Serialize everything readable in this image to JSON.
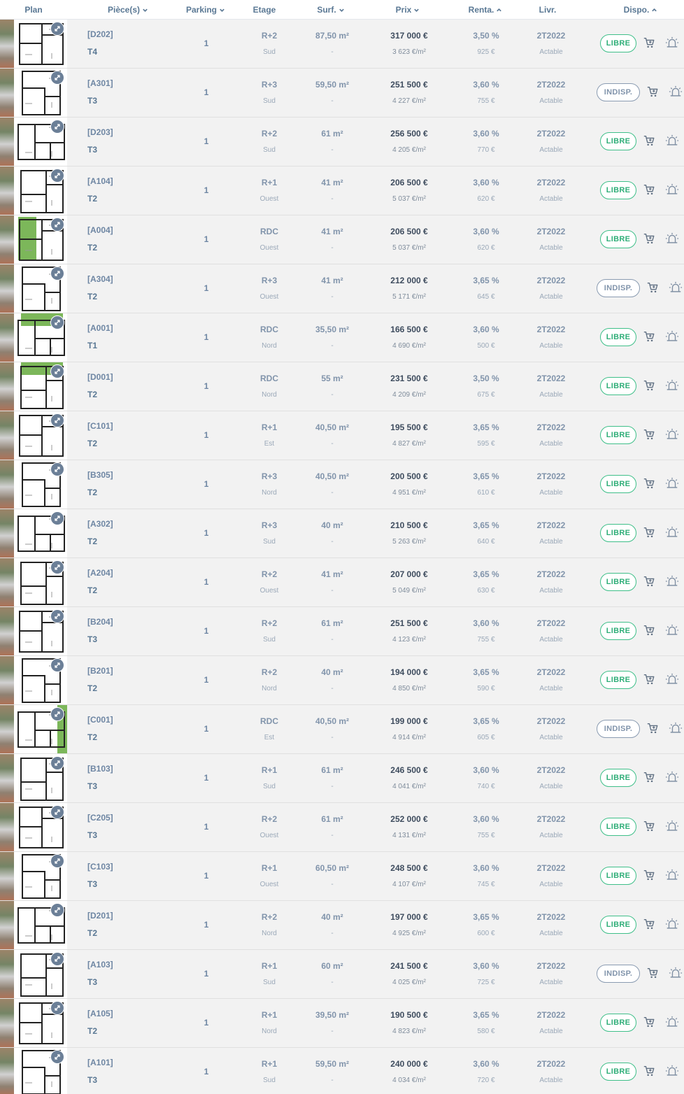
{
  "header": {
    "plan": "Plan",
    "pieces": "Pièce(s)",
    "parking": "Parking",
    "etage": "Etage",
    "surf": "Surf.",
    "prix": "Prix",
    "renta": "Renta.",
    "livr": "Livr.",
    "dispo": "Dispo."
  },
  "sort_icons": {
    "pieces": "chevron-down-icon",
    "parking": "chevron-down-icon",
    "surf": "chevron-down-icon",
    "prix": "chevron-down-icon",
    "renta": "chevron-up-icon",
    "dispo": "chevron-up-icon"
  },
  "colors": {
    "libre": "#2fae78",
    "indisp": "#8194ab",
    "price": "#3e4c5e",
    "header_text": "#5a7894"
  },
  "rows": [
    {
      "lot": "[D202]",
      "type": "T4",
      "parking": "1",
      "etage": "R+2",
      "orientation": "Sud",
      "surface": "87,50 m²",
      "surface_extra": "-",
      "prix": "317 000 €",
      "prix_m2": "3 623 €/m²",
      "renta": "3,50 %",
      "loyer": "925 €",
      "livraison": "2T2022",
      "acte": "Actable",
      "dispo": "LIBRE",
      "status": "libre",
      "garden": ""
    },
    {
      "lot": "[A301]",
      "type": "T3",
      "parking": "1",
      "etage": "R+3",
      "orientation": "Sud",
      "surface": "59,50 m²",
      "surface_extra": "-",
      "prix": "251 500 €",
      "prix_m2": "4 227 €/m²",
      "renta": "3,60 %",
      "loyer": "755 €",
      "livraison": "2T2022",
      "acte": "Actable",
      "dispo": "INDISP.",
      "status": "indisp",
      "garden": ""
    },
    {
      "lot": "[D203]",
      "type": "T3",
      "parking": "1",
      "etage": "R+2",
      "orientation": "Sud",
      "surface": "61 m²",
      "surface_extra": "-",
      "prix": "256 500 €",
      "prix_m2": "4 205 €/m²",
      "renta": "3,60 %",
      "loyer": "770 €",
      "livraison": "2T2022",
      "acte": "Actable",
      "dispo": "LIBRE",
      "status": "libre",
      "garden": ""
    },
    {
      "lot": "[A104]",
      "type": "T2",
      "parking": "1",
      "etage": "R+1",
      "orientation": "Ouest",
      "surface": "41 m²",
      "surface_extra": "-",
      "prix": "206 500 €",
      "prix_m2": "5 037 €/m²",
      "renta": "3,60 %",
      "loyer": "620 €",
      "livraison": "2T2022",
      "acte": "Actable",
      "dispo": "LIBRE",
      "status": "libre",
      "garden": ""
    },
    {
      "lot": "[A004]",
      "type": "T2",
      "parking": "1",
      "etage": "RDC",
      "orientation": "Ouest",
      "surface": "41 m²",
      "surface_extra": "-",
      "prix": "206 500 €",
      "prix_m2": "5 037 €/m²",
      "renta": "3,60 %",
      "loyer": "620 €",
      "livraison": "2T2022",
      "acte": "Actable",
      "dispo": "LIBRE",
      "status": "libre",
      "garden": "left"
    },
    {
      "lot": "[A304]",
      "type": "T2",
      "parking": "1",
      "etage": "R+3",
      "orientation": "Ouest",
      "surface": "41 m²",
      "surface_extra": "-",
      "prix": "212 000 €",
      "prix_m2": "5 171 €/m²",
      "renta": "3,65 %",
      "loyer": "645 €",
      "livraison": "2T2022",
      "acte": "Actable",
      "dispo": "INDISP.",
      "status": "indisp",
      "garden": ""
    },
    {
      "lot": "[A001]",
      "type": "T1",
      "parking": "1",
      "etage": "RDC",
      "orientation": "Nord",
      "surface": "35,50 m²",
      "surface_extra": "-",
      "prix": "166 500 €",
      "prix_m2": "4 690 €/m²",
      "renta": "3,60 %",
      "loyer": "500 €",
      "livraison": "2T2022",
      "acte": "Actable",
      "dispo": "LIBRE",
      "status": "libre",
      "garden": "top"
    },
    {
      "lot": "[D001]",
      "type": "T2",
      "parking": "1",
      "etage": "RDC",
      "orientation": "Nord",
      "surface": "55 m²",
      "surface_extra": "-",
      "prix": "231 500 €",
      "prix_m2": "4 209 €/m²",
      "renta": "3,50 %",
      "loyer": "675 €",
      "livraison": "2T2022",
      "acte": "Actable",
      "dispo": "LIBRE",
      "status": "libre",
      "garden": "top"
    },
    {
      "lot": "[C101]",
      "type": "T2",
      "parking": "1",
      "etage": "R+1",
      "orientation": "Est",
      "surface": "40,50 m²",
      "surface_extra": "-",
      "prix": "195 500 €",
      "prix_m2": "4 827 €/m²",
      "renta": "3,65 %",
      "loyer": "595 €",
      "livraison": "2T2022",
      "acte": "Actable",
      "dispo": "LIBRE",
      "status": "libre",
      "garden": ""
    },
    {
      "lot": "[B305]",
      "type": "T2",
      "parking": "1",
      "etage": "R+3",
      "orientation": "Nord",
      "surface": "40,50 m²",
      "surface_extra": "-",
      "prix": "200 500 €",
      "prix_m2": "4 951 €/m²",
      "renta": "3,65 %",
      "loyer": "610 €",
      "livraison": "2T2022",
      "acte": "Actable",
      "dispo": "LIBRE",
      "status": "libre",
      "garden": ""
    },
    {
      "lot": "[A302]",
      "type": "T2",
      "parking": "1",
      "etage": "R+3",
      "orientation": "Sud",
      "surface": "40 m²",
      "surface_extra": "-",
      "prix": "210 500 €",
      "prix_m2": "5 263 €/m²",
      "renta": "3,65 %",
      "loyer": "640 €",
      "livraison": "2T2022",
      "acte": "Actable",
      "dispo": "LIBRE",
      "status": "libre",
      "garden": ""
    },
    {
      "lot": "[A204]",
      "type": "T2",
      "parking": "1",
      "etage": "R+2",
      "orientation": "Ouest",
      "surface": "41 m²",
      "surface_extra": "-",
      "prix": "207 000 €",
      "prix_m2": "5 049 €/m²",
      "renta": "3,65 %",
      "loyer": "630 €",
      "livraison": "2T2022",
      "acte": "Actable",
      "dispo": "LIBRE",
      "status": "libre",
      "garden": ""
    },
    {
      "lot": "[B204]",
      "type": "T3",
      "parking": "1",
      "etage": "R+2",
      "orientation": "Sud",
      "surface": "61 m²",
      "surface_extra": "-",
      "prix": "251 500 €",
      "prix_m2": "4 123 €/m²",
      "renta": "3,60 %",
      "loyer": "755 €",
      "livraison": "2T2022",
      "acte": "Actable",
      "dispo": "LIBRE",
      "status": "libre",
      "garden": ""
    },
    {
      "lot": "[B201]",
      "type": "T2",
      "parking": "1",
      "etage": "R+2",
      "orientation": "Nord",
      "surface": "40 m²",
      "surface_extra": "-",
      "prix": "194 000 €",
      "prix_m2": "4 850 €/m²",
      "renta": "3,65 %",
      "loyer": "590 €",
      "livraison": "2T2022",
      "acte": "Actable",
      "dispo": "LIBRE",
      "status": "libre",
      "garden": ""
    },
    {
      "lot": "[C001]",
      "type": "T2",
      "parking": "1",
      "etage": "RDC",
      "orientation": "Est",
      "surface": "40,50 m²",
      "surface_extra": "-",
      "prix": "199 000 €",
      "prix_m2": "4 914 €/m²",
      "renta": "3,65 %",
      "loyer": "605 €",
      "livraison": "2T2022",
      "acte": "Actable",
      "dispo": "INDISP.",
      "status": "indisp",
      "garden": "right"
    },
    {
      "lot": "[B103]",
      "type": "T3",
      "parking": "1",
      "etage": "R+1",
      "orientation": "Sud",
      "surface": "61 m²",
      "surface_extra": "-",
      "prix": "246 500 €",
      "prix_m2": "4 041 €/m²",
      "renta": "3,60 %",
      "loyer": "740 €",
      "livraison": "2T2022",
      "acte": "Actable",
      "dispo": "LIBRE",
      "status": "libre",
      "garden": ""
    },
    {
      "lot": "[C205]",
      "type": "T3",
      "parking": "1",
      "etage": "R+2",
      "orientation": "Ouest",
      "surface": "61 m²",
      "surface_extra": "-",
      "prix": "252 000 €",
      "prix_m2": "4 131 €/m²",
      "renta": "3,60 %",
      "loyer": "755 €",
      "livraison": "2T2022",
      "acte": "Actable",
      "dispo": "LIBRE",
      "status": "libre",
      "garden": ""
    },
    {
      "lot": "[C103]",
      "type": "T3",
      "parking": "1",
      "etage": "R+1",
      "orientation": "Ouest",
      "surface": "60,50 m²",
      "surface_extra": "-",
      "prix": "248 500 €",
      "prix_m2": "4 107 €/m²",
      "renta": "3,60 %",
      "loyer": "745 €",
      "livraison": "2T2022",
      "acte": "Actable",
      "dispo": "LIBRE",
      "status": "libre",
      "garden": ""
    },
    {
      "lot": "[D201]",
      "type": "T2",
      "parking": "1",
      "etage": "R+2",
      "orientation": "Nord",
      "surface": "40 m²",
      "surface_extra": "-",
      "prix": "197 000 €",
      "prix_m2": "4 925 €/m²",
      "renta": "3,65 %",
      "loyer": "600 €",
      "livraison": "2T2022",
      "acte": "Actable",
      "dispo": "LIBRE",
      "status": "libre",
      "garden": ""
    },
    {
      "lot": "[A103]",
      "type": "T3",
      "parking": "1",
      "etage": "R+1",
      "orientation": "Sud",
      "surface": "60 m²",
      "surface_extra": "-",
      "prix": "241 500 €",
      "prix_m2": "4 025 €/m²",
      "renta": "3,60 %",
      "loyer": "725 €",
      "livraison": "2T2022",
      "acte": "Actable",
      "dispo": "INDISP.",
      "status": "indisp",
      "garden": ""
    },
    {
      "lot": "[A105]",
      "type": "T2",
      "parking": "1",
      "etage": "R+1",
      "orientation": "Nord",
      "surface": "39,50 m²",
      "surface_extra": "-",
      "prix": "190 500 €",
      "prix_m2": "4 823 €/m²",
      "renta": "3,65 %",
      "loyer": "580 €",
      "livraison": "2T2022",
      "acte": "Actable",
      "dispo": "LIBRE",
      "status": "libre",
      "garden": ""
    },
    {
      "lot": "[A101]",
      "type": "T3",
      "parking": "1",
      "etage": "R+1",
      "orientation": "Sud",
      "surface": "59,50 m²",
      "surface_extra": "-",
      "prix": "240 000 €",
      "prix_m2": "4 034 €/m²",
      "renta": "3,60 %",
      "loyer": "720 €",
      "livraison": "2T2022",
      "acte": "Actable",
      "dispo": "LIBRE",
      "status": "libre",
      "garden": ""
    }
  ]
}
